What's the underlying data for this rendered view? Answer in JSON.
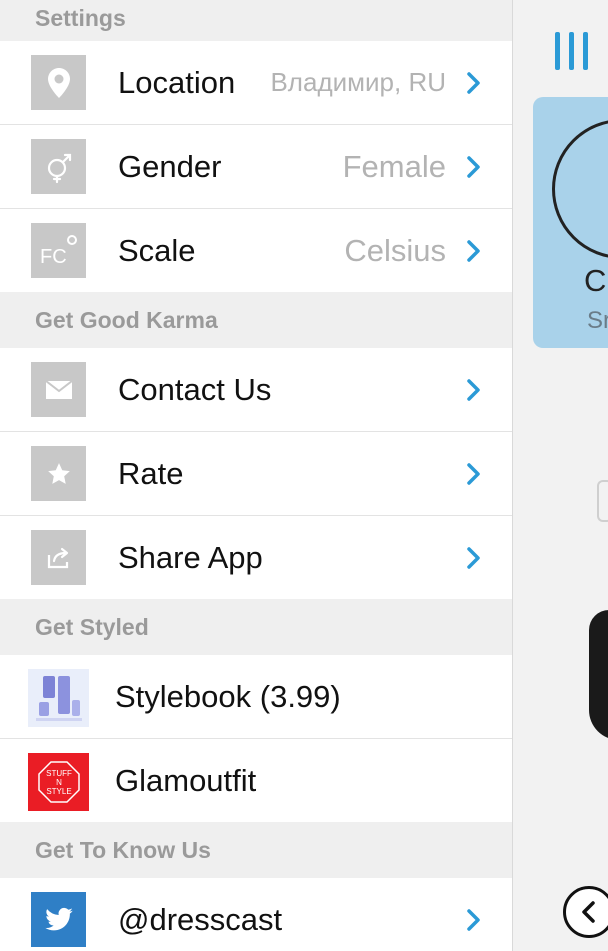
{
  "sections": [
    {
      "header": "Settings",
      "rows": [
        {
          "label": "Location",
          "value": "Владимир, RU",
          "icon": "location-pin-icon"
        },
        {
          "label": "Gender",
          "value": "Female",
          "icon": "gender-icon"
        },
        {
          "label": "Scale",
          "value": "Celsius",
          "icon": "temperature-scale-icon"
        }
      ]
    },
    {
      "header": "Get Good Karma",
      "rows": [
        {
          "label": "Contact Us",
          "icon": "envelope-icon"
        },
        {
          "label": "Rate",
          "icon": "star-icon"
        },
        {
          "label": "Share App",
          "icon": "share-icon"
        }
      ]
    },
    {
      "header": "Get Styled",
      "rows": [
        {
          "label": "Stylebook (3.99)",
          "icon": "stylebook-app-icon"
        },
        {
          "label": "Glamoutfit",
          "icon": "glamoutfit-app-icon",
          "icon_text": [
            "STUFF",
            "N",
            "STYLE"
          ]
        }
      ]
    },
    {
      "header": "Get To Know Us",
      "rows": [
        {
          "label": "@dresscast",
          "icon": "twitter-icon"
        }
      ]
    }
  ],
  "right_panel": {
    "card_name": "C",
    "card_sub": "Sr"
  },
  "colors": {
    "accent": "#2b9ad6",
    "icon_bg": "#c8c8c8",
    "twitter": "#2f7fc6",
    "glamoutfit": "#ea1d25",
    "card": "#a9d2ea"
  }
}
